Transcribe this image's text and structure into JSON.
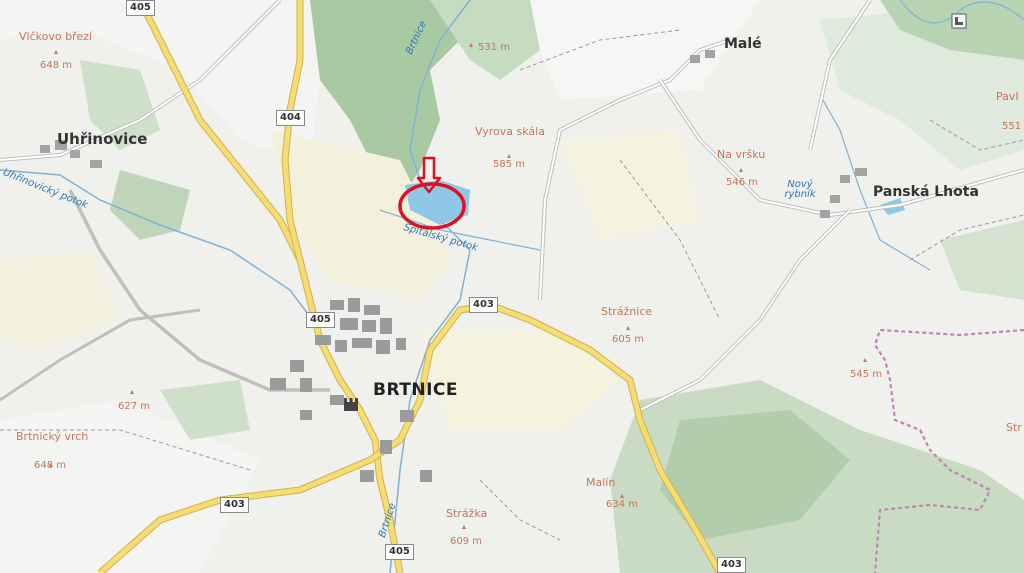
{
  "places": {
    "brtnice": "BRTNICE",
    "uhrinovice": "Uhřinovice",
    "panska_lhota": "Panská Lhota",
    "male": "Malé"
  },
  "peaks": {
    "vlckovo_breh": "Vlčkovo březí",
    "vlckovo_breh_elev": "648 m",
    "vyrova_skala": "Vyrova skála",
    "vyrova_skala_elev": "585 m",
    "peak_531_elev": "531 m",
    "na_vrsku": "Na vršku",
    "na_vrsku_elev": "546 m",
    "straznice": "Strážnice",
    "straznice_elev": "605 m",
    "peak_627_elev": "627 m",
    "peak_545_elev": "545 m",
    "brtnicky_vrch": "Brtnický vrch",
    "brtnicky_vrch_elev": "648 m",
    "malin": "Malín",
    "malin_elev": "634 m",
    "strazka": "Strážka",
    "strazka_elev": "609 m",
    "pavl_partial": "Pavl",
    "pavl_elev_partial": "551",
    "str_partial": "Str"
  },
  "water": {
    "brtnice_river_top": "Brtnice",
    "brtnice_river_bottom": "Brtnice",
    "uhrinovicky_potok": "Uhřinovický potok",
    "spitalsky_potok": "Špitálský potok",
    "novy_rybnik": "Nový rybník"
  },
  "roads": {
    "r405_top": "405",
    "r404": "404",
    "r405_mid": "405",
    "r403_mid": "403",
    "r403_left": "403",
    "r405_bottom": "405",
    "r403_bottom": "403"
  },
  "marker": {
    "color": "#e01020"
  }
}
